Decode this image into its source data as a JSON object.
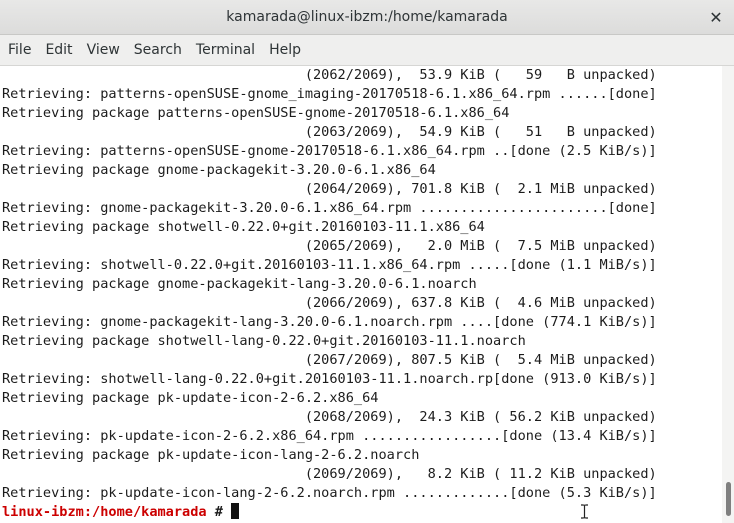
{
  "window": {
    "title": "kamarada@linux-ibzm:/home/kamarada",
    "close_glyph": "✕"
  },
  "menu": {
    "items": [
      "File",
      "Edit",
      "View",
      "Search",
      "Terminal",
      "Help"
    ]
  },
  "terminal": {
    "lines": [
      "                                     (2062/2069),  53.9 KiB (   59   B unpacked)",
      "Retrieving: patterns-openSUSE-gnome_imaging-20170518-6.1.x86_64.rpm ......[done]",
      "Retrieving package patterns-openSUSE-gnome-20170518-6.1.x86_64",
      "                                     (2063/2069),  54.9 KiB (   51   B unpacked)",
      "Retrieving: patterns-openSUSE-gnome-20170518-6.1.x86_64.rpm ..[done (2.5 KiB/s)]",
      "Retrieving package gnome-packagekit-3.20.0-6.1.x86_64",
      "                                     (2064/2069), 701.8 KiB (  2.1 MiB unpacked)",
      "Retrieving: gnome-packagekit-3.20.0-6.1.x86_64.rpm .......................[done]",
      "Retrieving package shotwell-0.22.0+git.20160103-11.1.x86_64",
      "                                     (2065/2069),   2.0 MiB (  7.5 MiB unpacked)",
      "Retrieving: shotwell-0.22.0+git.20160103-11.1.x86_64.rpm .....[done (1.1 MiB/s)]",
      "Retrieving package gnome-packagekit-lang-3.20.0-6.1.noarch",
      "                                     (2066/2069), 637.8 KiB (  4.6 MiB unpacked)",
      "Retrieving: gnome-packagekit-lang-3.20.0-6.1.noarch.rpm ....[done (774.1 KiB/s)]",
      "Retrieving package shotwell-lang-0.22.0+git.20160103-11.1.noarch",
      "                                     (2067/2069), 807.5 KiB (  5.4 MiB unpacked)",
      "Retrieving: shotwell-lang-0.22.0+git.20160103-11.1.noarch.rp[done (913.0 KiB/s)]",
      "Retrieving package pk-update-icon-2-6.2.x86_64",
      "                                     (2068/2069),  24.3 KiB ( 56.2 KiB unpacked)",
      "Retrieving: pk-update-icon-2-6.2.x86_64.rpm .................[done (13.4 KiB/s)]",
      "Retrieving package pk-update-icon-lang-2-6.2.noarch",
      "                                     (2069/2069),   8.2 KiB ( 11.2 KiB unpacked)",
      "Retrieving: pk-update-icon-lang-2-6.2.noarch.rpm .............[done (5.3 KiB/s)]"
    ],
    "prompt_path": "linux-ibzm:/home/kamarada",
    "prompt_symbol": " # "
  }
}
